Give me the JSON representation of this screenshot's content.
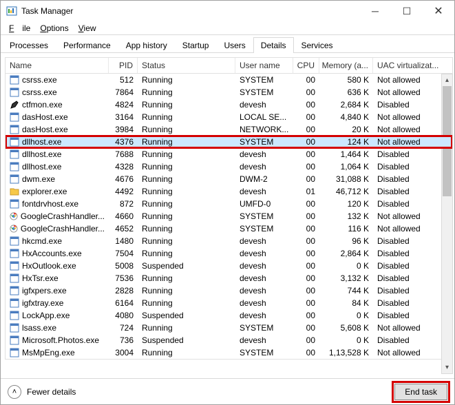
{
  "window": {
    "title": "Task Manager"
  },
  "menu": {
    "file": "File",
    "options": "Options",
    "view": "View"
  },
  "tabs": {
    "processes": "Processes",
    "performance": "Performance",
    "app_history": "App history",
    "startup": "Startup",
    "users": "Users",
    "details": "Details",
    "services": "Services"
  },
  "columns": {
    "name": "Name",
    "pid": "PID",
    "status": "Status",
    "user": "User name",
    "cpu": "CPU",
    "mem": "Memory (a...",
    "uac": "UAC virtualizat..."
  },
  "rows": [
    {
      "icon": "app",
      "name": "csrss.exe",
      "pid": "512",
      "status": "Running",
      "user": "SYSTEM",
      "cpu": "00",
      "mem": "580 K",
      "uac": "Not allowed"
    },
    {
      "icon": "app",
      "name": "csrss.exe",
      "pid": "7864",
      "status": "Running",
      "user": "SYSTEM",
      "cpu": "00",
      "mem": "636 K",
      "uac": "Not allowed"
    },
    {
      "icon": "pen",
      "name": "ctfmon.exe",
      "pid": "4824",
      "status": "Running",
      "user": "devesh",
      "cpu": "00",
      "mem": "2,684 K",
      "uac": "Disabled"
    },
    {
      "icon": "app",
      "name": "dasHost.exe",
      "pid": "3164",
      "status": "Running",
      "user": "LOCAL SE...",
      "cpu": "00",
      "mem": "4,840 K",
      "uac": "Not allowed"
    },
    {
      "icon": "app",
      "name": "dasHost.exe",
      "pid": "3984",
      "status": "Running",
      "user": "NETWORK...",
      "cpu": "00",
      "mem": "20 K",
      "uac": "Not allowed"
    },
    {
      "icon": "app",
      "name": "dllhost.exe",
      "pid": "4376",
      "status": "Running",
      "user": "SYSTEM",
      "cpu": "00",
      "mem": "124 K",
      "uac": "Not allowed",
      "selected": true,
      "highlight": true
    },
    {
      "icon": "app",
      "name": "dllhost.exe",
      "pid": "7688",
      "status": "Running",
      "user": "devesh",
      "cpu": "00",
      "mem": "1,464 K",
      "uac": "Disabled"
    },
    {
      "icon": "app",
      "name": "dllhost.exe",
      "pid": "4328",
      "status": "Running",
      "user": "devesh",
      "cpu": "00",
      "mem": "1,064 K",
      "uac": "Disabled"
    },
    {
      "icon": "app",
      "name": "dwm.exe",
      "pid": "4676",
      "status": "Running",
      "user": "DWM-2",
      "cpu": "00",
      "mem": "31,088 K",
      "uac": "Disabled"
    },
    {
      "icon": "folder",
      "name": "explorer.exe",
      "pid": "4492",
      "status": "Running",
      "user": "devesh",
      "cpu": "01",
      "mem": "46,712 K",
      "uac": "Disabled"
    },
    {
      "icon": "app",
      "name": "fontdrvhost.exe",
      "pid": "872",
      "status": "Running",
      "user": "UMFD-0",
      "cpu": "00",
      "mem": "120 K",
      "uac": "Disabled"
    },
    {
      "icon": "chrome",
      "name": "GoogleCrashHandler...",
      "pid": "4660",
      "status": "Running",
      "user": "SYSTEM",
      "cpu": "00",
      "mem": "132 K",
      "uac": "Not allowed"
    },
    {
      "icon": "chrome",
      "name": "GoogleCrashHandler...",
      "pid": "4652",
      "status": "Running",
      "user": "SYSTEM",
      "cpu": "00",
      "mem": "116 K",
      "uac": "Not allowed"
    },
    {
      "icon": "app",
      "name": "hkcmd.exe",
      "pid": "1480",
      "status": "Running",
      "user": "devesh",
      "cpu": "00",
      "mem": "96 K",
      "uac": "Disabled"
    },
    {
      "icon": "app",
      "name": "HxAccounts.exe",
      "pid": "7504",
      "status": "Running",
      "user": "devesh",
      "cpu": "00",
      "mem": "2,864 K",
      "uac": "Disabled"
    },
    {
      "icon": "app",
      "name": "HxOutlook.exe",
      "pid": "5008",
      "status": "Suspended",
      "user": "devesh",
      "cpu": "00",
      "mem": "0 K",
      "uac": "Disabled"
    },
    {
      "icon": "app",
      "name": "HxTsr.exe",
      "pid": "7536",
      "status": "Running",
      "user": "devesh",
      "cpu": "00",
      "mem": "3,132 K",
      "uac": "Disabled"
    },
    {
      "icon": "app",
      "name": "igfxpers.exe",
      "pid": "2828",
      "status": "Running",
      "user": "devesh",
      "cpu": "00",
      "mem": "744 K",
      "uac": "Disabled"
    },
    {
      "icon": "app",
      "name": "igfxtray.exe",
      "pid": "6164",
      "status": "Running",
      "user": "devesh",
      "cpu": "00",
      "mem": "84 K",
      "uac": "Disabled"
    },
    {
      "icon": "app",
      "name": "LockApp.exe",
      "pid": "4080",
      "status": "Suspended",
      "user": "devesh",
      "cpu": "00",
      "mem": "0 K",
      "uac": "Disabled"
    },
    {
      "icon": "app",
      "name": "lsass.exe",
      "pid": "724",
      "status": "Running",
      "user": "SYSTEM",
      "cpu": "00",
      "mem": "5,608 K",
      "uac": "Not allowed"
    },
    {
      "icon": "app",
      "name": "Microsoft.Photos.exe",
      "pid": "736",
      "status": "Suspended",
      "user": "devesh",
      "cpu": "00",
      "mem": "0 K",
      "uac": "Disabled"
    },
    {
      "icon": "app",
      "name": "MsMpEng.exe",
      "pid": "3004",
      "status": "Running",
      "user": "SYSTEM",
      "cpu": "00",
      "mem": "1,13,528 K",
      "uac": "Not allowed"
    }
  ],
  "footer": {
    "fewer": "Fewer details",
    "end_task": "End task"
  }
}
